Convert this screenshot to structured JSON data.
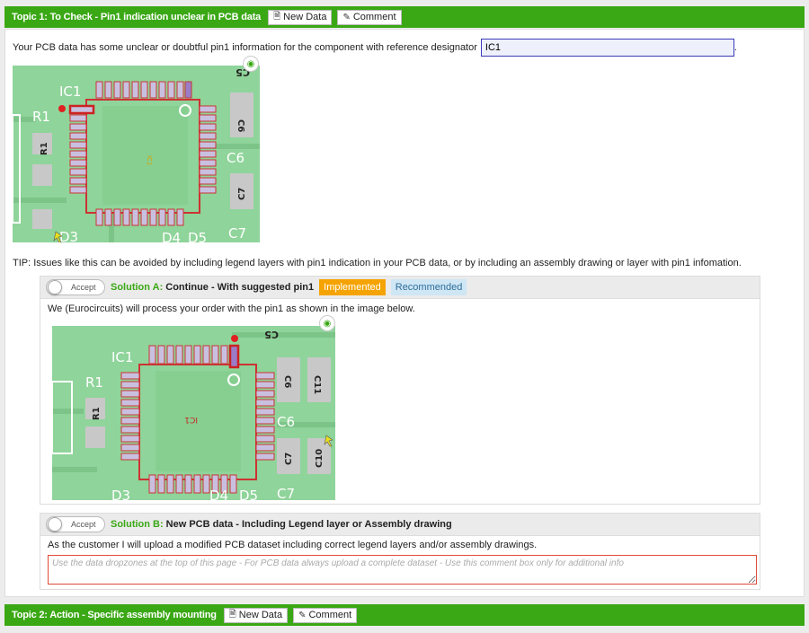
{
  "topic1": {
    "title": "Topic 1: To Check - Pin1 indication unclear in PCB data",
    "new_data_label": "New Data",
    "comment_label": "Comment",
    "intro_text": "Your PCB data has some unclear or doubtful pin1 information for the component with reference designator",
    "ref_designator_value": "IC1",
    "intro_suffix": ".",
    "image1_labels": {
      "ic": "IC1",
      "r1": "R1",
      "r1v": "R1",
      "c5": "C5",
      "c6": "C6",
      "c6v": "C6",
      "c7": "C7",
      "c7v": "C7",
      "d3": "D3",
      "d4": "D4",
      "d5": "D5",
      "center": "IC1"
    },
    "tip_text": "TIP: Issues like this can be avoided by including legend layers with pin1 indication in your PCB data, or by including an assembly drawing or layer with pin1 infomation.",
    "solution_a": {
      "toggle_label": "Accept",
      "name": "Solution A:",
      "description": "Continue - With suggested pin1",
      "badge_implemented": "Implemented",
      "badge_recommended": "Recommended",
      "body_text": "We (Eurocircuits) will process your order with the pin1 as shown in the image below.",
      "image2_labels": {
        "ic": "IC1",
        "r1": "R1",
        "r1v": "R1",
        "c5": "C5",
        "c6": "C6",
        "c6v": "C6",
        "c7": "C7",
        "c7v": "C7",
        "c10": "C10",
        "c11": "C11",
        "d3": "D3",
        "d4": "D4",
        "d5": "D5",
        "center": "IC1"
      }
    },
    "solution_b": {
      "toggle_label": "Accept",
      "name": "Solution B:",
      "description": "New PCB data - Including Legend layer or Assembly drawing",
      "body_text": "As the customer I will upload a modified PCB dataset including correct legend layers and/or assembly drawings.",
      "comment_placeholder": "Use the data dropzones at the top of this page - For PCB data always upload a complete dataset - Use this comment box only for additional info"
    }
  },
  "topic2": {
    "title": "Topic 2: Action - Specific assembly mounting",
    "new_data_label": "New Data",
    "comment_label": "Comment"
  },
  "colors": {
    "topic_bar": "#3aa815",
    "implemented": "#f5a300",
    "recommended_bg": "#cfe6f5",
    "pcb_board": "#8fd49a",
    "pin_pad": "#c9c0e0",
    "pin_outline": "#cc3333",
    "invalid_border": "#e04a3a"
  },
  "icons": {
    "new_data": "document-icon",
    "comment": "edit-icon",
    "eye": "eye-icon"
  }
}
